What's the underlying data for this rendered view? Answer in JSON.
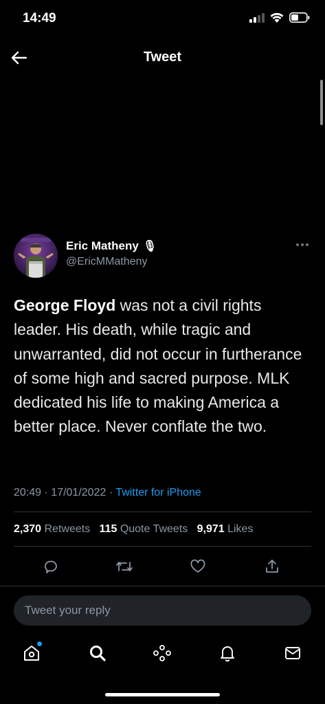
{
  "status_bar": {
    "time": "14:49"
  },
  "header": {
    "title": "Tweet"
  },
  "tweet": {
    "author_name": "Eric Matheny",
    "author_emoji": "🎙",
    "handle": "@EricMMatheny",
    "text_bold": "George Floyd",
    "text_rest": " was not a civil rights leader. His death, while tragic and unwarranted, did not occur in furtherance of some high and sacred purpose. MLK dedicated his life to making America a better place. Never conflate the two.",
    "time": "20:49",
    "date": "17/01/2022",
    "source": "Twitter for iPhone"
  },
  "stats": {
    "retweets_count": "2,370",
    "retweets_label": "Retweets",
    "quotes_count": "115",
    "quotes_label": "Quote Tweets",
    "likes_count": "9,971",
    "likes_label": "Likes"
  },
  "reply": {
    "placeholder": "Tweet your reply"
  },
  "tab_bar": {
    "items": [
      "home-icon",
      "search-icon",
      "spaces-icon",
      "notifications-icon",
      "messages-icon"
    ]
  },
  "colors": {
    "background": "#000000",
    "accent": "#1d9bf0",
    "secondary_text": "#8b98a5",
    "divider": "#2f3336"
  }
}
